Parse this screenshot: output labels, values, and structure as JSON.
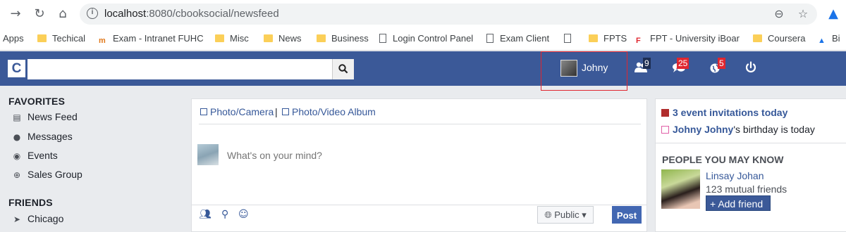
{
  "browser": {
    "url_host": "localhost",
    "url_path": ":8080/cbooksocial/newsfeed",
    "bookmarks": [
      {
        "label": "Apps"
      },
      {
        "label": "Techical"
      },
      {
        "label": "Exam - Intranet FUHC"
      },
      {
        "label": "Misc"
      },
      {
        "label": "News"
      },
      {
        "label": "Business"
      },
      {
        "label": "Login Control Panel"
      },
      {
        "label": "Exam Client"
      },
      {
        "label": "FPTS"
      },
      {
        "label": "FPT - University iBoar"
      },
      {
        "label": "Coursera"
      },
      {
        "label": "Bi"
      }
    ]
  },
  "app": {
    "logo": "C",
    "search_placeholder": "",
    "profile_name": "Johny",
    "badges": {
      "friends": "9",
      "messages": "25",
      "notifications": "5"
    }
  },
  "sidebar": {
    "favorites_title": "FAVORITES",
    "favorites": [
      {
        "label": "News Feed"
      },
      {
        "label": "Messages"
      },
      {
        "label": "Events"
      },
      {
        "label": "Sales Group"
      }
    ],
    "friends_title": "FRIENDS",
    "friends": [
      {
        "label": "Chicago"
      }
    ]
  },
  "composer": {
    "photo_camera": "Photo/Camera",
    "separator": "|",
    "photo_album": "Photo/Video Album",
    "placeholder": "What's on your mind?",
    "privacy": "Public",
    "post": "Post"
  },
  "right": {
    "event_invitations": "3 event invitations today",
    "birthday_name": "Johny Johny",
    "birthday_suffix": "'s birthday is today",
    "pymk_title": "PEOPLE YOU MAY KNOW",
    "pymk": {
      "name": "Linsay Johan",
      "mutual": "123 mutual friends",
      "add_label": "Add friend"
    }
  },
  "colors": {
    "brand": "#3b5998",
    "badge_red": "#e0262f",
    "link": "#365899"
  }
}
